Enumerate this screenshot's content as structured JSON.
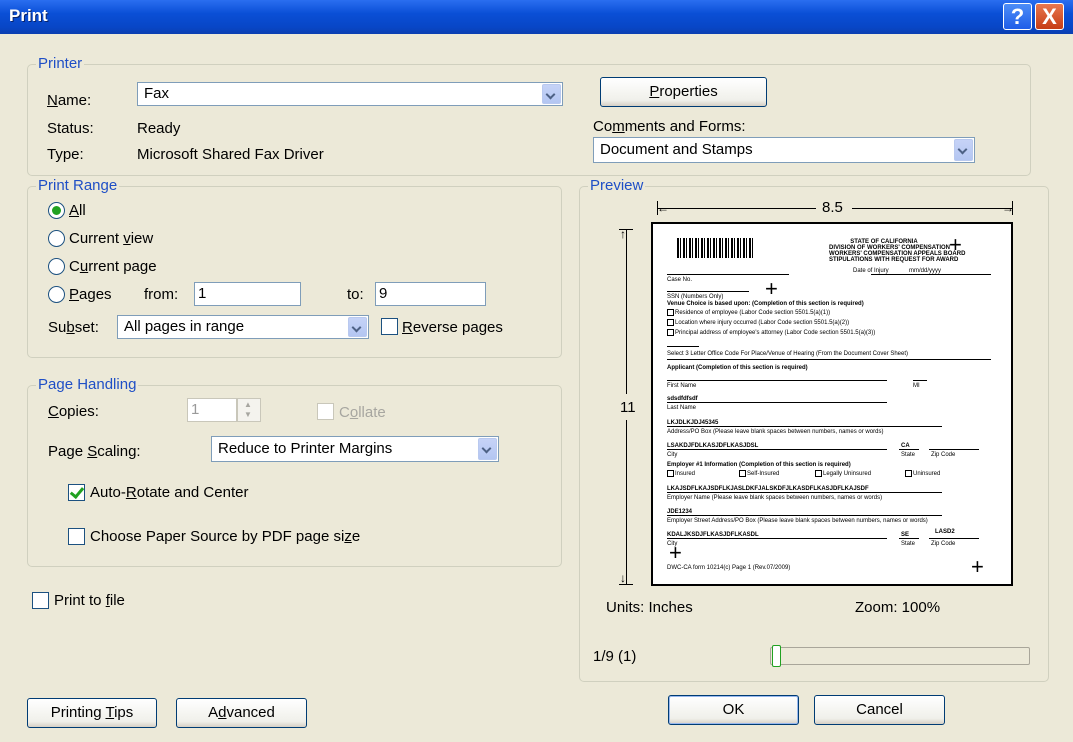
{
  "title": "Print",
  "titlebar": {
    "help": "?",
    "close": "X"
  },
  "printer": {
    "legend": "Printer",
    "name_label": "Name:",
    "name_value": "Fax",
    "status_label": "Status:",
    "status_value": "Ready",
    "type_label": "Type:",
    "type_value": "Microsoft Shared Fax Driver",
    "properties_button": "Properties",
    "comments_label": "Comments and Forms:",
    "comments_value": "Document and Stamps"
  },
  "print_range": {
    "legend": "Print Range",
    "all": "All",
    "current_view": "Current view",
    "current_page": "Current page",
    "pages": "Pages",
    "from_label": "from:",
    "from_value": "1",
    "to_label": "to:",
    "to_value": "9",
    "subset_label": "Subset:",
    "subset_value": "All pages in range",
    "reverse_label": "Reverse pages"
  },
  "page_handling": {
    "legend": "Page Handling",
    "copies_label": "Copies:",
    "copies_value": "1",
    "collate_label": "Collate",
    "scaling_label": "Page Scaling:",
    "scaling_value": "Reduce to Printer Margins",
    "auto_rotate": "Auto-Rotate and Center",
    "paper_source": "Choose Paper Source by PDF page size"
  },
  "print_to_file": "Print to file",
  "preview": {
    "legend": "Preview",
    "width": "8.5",
    "height": "11",
    "units": "Units: Inches",
    "zoom": "Zoom: 100%",
    "page_indicator": "1/9 (1)",
    "page_position": 0.0,
    "doc": {
      "h1": "STATE OF CALIFORNIA",
      "h2": "DIVISION OF WORKERS' COMPENSATION",
      "h3": "WORKERS' COMPENSATION APPEALS BOARD",
      "h4": "STIPULATIONS WITH REQUEST FOR AWARD",
      "date_of_injury": "Date of Injury",
      "date_value": "mm/dd/yyyy",
      "case_no": "Case No.",
      "ssn": "SSN (Numbers Only)",
      "venue": "Venue Choice is based upon: (Completion of this section is required)",
      "venue1": "Residence of employee (Labor Code section 5501.5(a)(1))",
      "venue2": "Location where injury occurred (Labor Code section 5501.5(a)(2))",
      "venue3": "Principal address of employee's attorney (Labor Code section 5501.5(a)(3))",
      "office": "Select 3 Letter Office Code For Place/Venue of Hearing (From the Document Cover Sheet)",
      "applicant": "Applicant (Completion of this section is required)",
      "first_name": "First Name",
      "mi": "MI",
      "last_value": "sdsdfdfsdf",
      "last_name": "Last Name",
      "address_value": "LKJDLKJDJ45345",
      "address": "Address/PO Box (Please leave blank spaces between numbers, names or words)",
      "city_value": "LSAKDJFDLKASJDFLKASJDSL",
      "state_value": "CA",
      "city": "City",
      "state": "State",
      "zip": "Zip Code",
      "employer": "Employer #1 Information (Completion of this section is required)",
      "insured": "Insured",
      "self_insured": "Self-Insured",
      "legally": "Legally Uninsured",
      "uninsured": "Uninsured",
      "employer_value": "LKAJSDFLKAJSDFLKJASLDKFJALSKDFJLKASDFLKASJDFLKAJSDF",
      "employer_name": "Employer Name (Please leave blank spaces between numbers, names or words)",
      "street_value": "JDE1234",
      "street": "Employer Street Address/PO Box (Please leave blank spaces between numbers, names or words)",
      "city2_value": "KDALJKSDJFLKASJDFLKASDL",
      "state2_value": "SE",
      "zip2_value": "LASD2",
      "footer": "DWC-CA form 10214(c) Page 1 (Rev.07/2009)"
    }
  },
  "buttons": {
    "printing_tips": "Printing Tips",
    "advanced": "Advanced",
    "ok": "OK",
    "cancel": "Cancel"
  }
}
